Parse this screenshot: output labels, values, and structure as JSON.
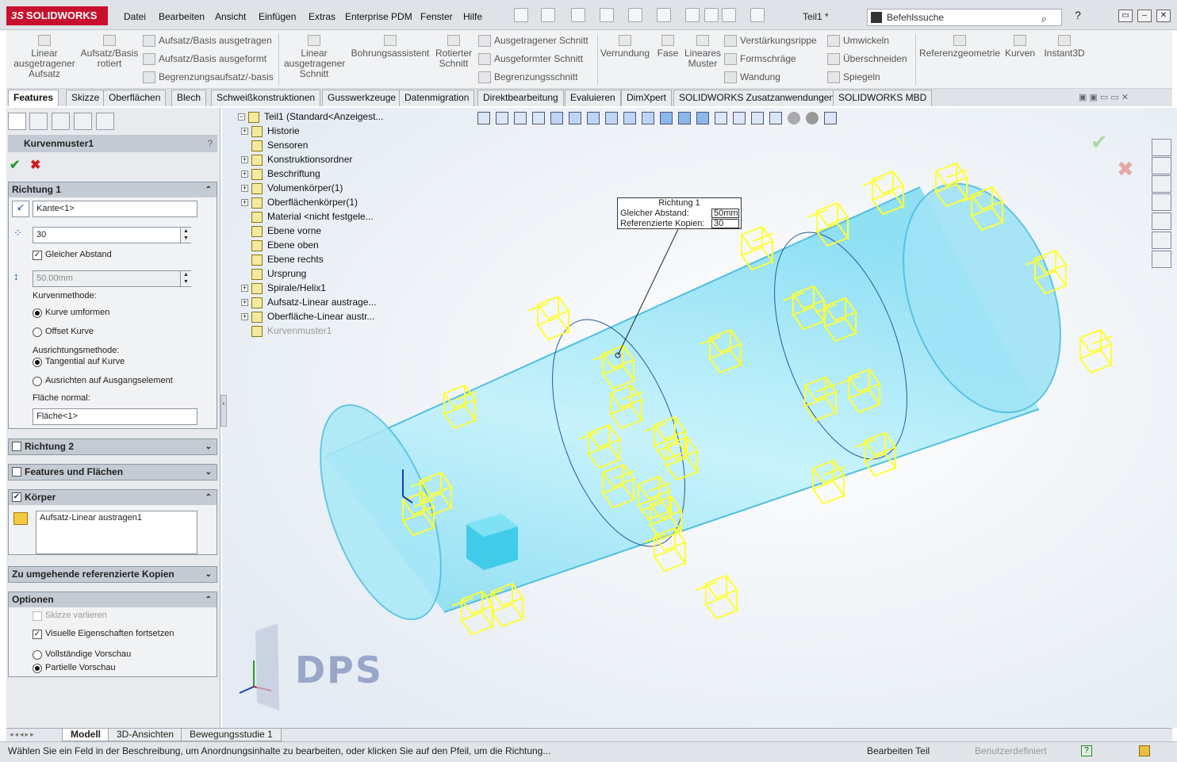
{
  "app": {
    "brand": "SOLIDWORKS",
    "doc_title": "Teil1 *"
  },
  "menu": [
    "Datei",
    "Bearbeiten",
    "Ansicht",
    "Einfügen",
    "Extras",
    "Enterprise PDM",
    "Fenster",
    "Hilfe"
  ],
  "search": {
    "placeholder": "Befehlssuche"
  },
  "ribbon": {
    "big": [
      "Linear ausgetragener Aufsatz",
      "Aufsatz/Basis rotiert",
      "Linear ausgetragener Schnitt",
      "Bohrungsassistent",
      "Rotierter Schnitt",
      "Verrundung",
      "Fase",
      "Lineares Muster",
      "Referenzgeometrie",
      "Kurven",
      "Instant3D"
    ],
    "small1": [
      "Aufsatz/Basis ausgetragen",
      "Aufsatz/Basis ausgeformt",
      "Begrenzungsaufsatz/-basis"
    ],
    "small2": [
      "Ausgetragener Schnitt",
      "Ausgeformter Schnitt",
      "Begrenzungsschnitt"
    ],
    "small3": [
      "Verstärkungsrippe",
      "Formschräge",
      "Wandung"
    ],
    "small4": [
      "Umwickeln",
      "Überschneiden",
      "Spiegeln"
    ]
  },
  "tabs": [
    "Features",
    "Skizze",
    "Oberflächen",
    "Blech",
    "Schweißkonstruktionen",
    "Gusswerkzeuge",
    "Datenmigration",
    "Direktbearbeitung",
    "Evaluieren",
    "DimXpert",
    "SOLIDWORKS Zusatzanwendungen",
    "SOLIDWORKS MBD"
  ],
  "pm": {
    "title": "Kurvenmuster1",
    "help": "?",
    "dir1": {
      "title": "Richtung 1",
      "edge": "Kante<1>",
      "count": "30",
      "equal_spacing": "Gleicher Abstand",
      "spacing": "50.00mm",
      "curve_method_label": "Kurvenmethode:",
      "curve_opt1": "Kurve umformen",
      "curve_opt2": "Offset Kurve",
      "align_label": "Ausrichtungsmethode:",
      "align_opt1": "Tangential auf Kurve",
      "align_opt2": "Ausrichten auf Ausgangselement",
      "face_label": "Fläche normal:",
      "face": "Fläche<1>"
    },
    "dir2": "Richtung 2",
    "features": "Features und Flächen",
    "bodies": {
      "title": "Körper",
      "item": "Aufsatz-Linear austragen1"
    },
    "skip": "Zu umgehende referenzierte Kopien",
    "options": {
      "title": "Optionen",
      "vary": "Skizze variieren",
      "visual": "Visuelle Eigenschaften fortsetzen",
      "full": "Vollständige Vorschau",
      "partial": "Partielle Vorschau"
    }
  },
  "tree": [
    {
      "label": "Teil1  (Standard<Anzeigest...",
      "exp": "−"
    },
    {
      "label": "Historie",
      "exp": "+"
    },
    {
      "label": "Sensoren",
      "exp": ""
    },
    {
      "label": "Konstruktionsordner",
      "exp": "+"
    },
    {
      "label": "Beschriftung",
      "exp": "+"
    },
    {
      "label": "Volumenkörper(1)",
      "exp": "+"
    },
    {
      "label": "Oberflächenkörper(1)",
      "exp": "+"
    },
    {
      "label": "Material <nicht festgele...",
      "exp": ""
    },
    {
      "label": "Ebene vorne",
      "exp": ""
    },
    {
      "label": "Ebene oben",
      "exp": ""
    },
    {
      "label": "Ebene rechts",
      "exp": ""
    },
    {
      "label": "Ursprung",
      "exp": ""
    },
    {
      "label": "Spirale/Helix1",
      "exp": "+"
    },
    {
      "label": "Aufsatz-Linear austrage...",
      "exp": "+"
    },
    {
      "label": "Oberfläche-Linear austr...",
      "exp": "+"
    },
    {
      "label": "Kurvenmuster1",
      "exp": ""
    }
  ],
  "callout": {
    "title": "Richtung 1",
    "k1": "Gleicher Abstand:",
    "v1": "50mm",
    "k2": "Referenzierte Kopien:",
    "v2": "30"
  },
  "watermark": "DPS",
  "bottom_tabs": [
    "Modell",
    "3D-Ansichten",
    "Bewegungsstudie 1"
  ],
  "status": {
    "msg": "Wählen Sie ein Feld in der Beschreibung, um Anordnungsinhalte zu bearbeiten, oder klicken Sie auf den Pfeil, um die Richtung...",
    "mode": "Bearbeiten Teil",
    "units": "Benutzerdefiniert"
  },
  "colors": {
    "accent": "#c8102e",
    "preview": "#ffff33",
    "body": "#7fe0f5"
  }
}
